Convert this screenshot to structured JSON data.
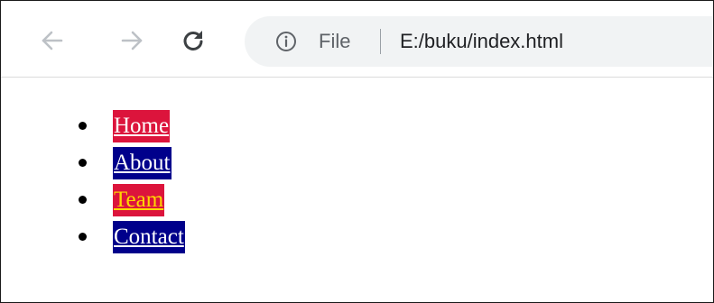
{
  "browser": {
    "origin_label": "File",
    "url": "E:/buku/index.html",
    "icons": {
      "back": "arrow-left-icon",
      "forward": "arrow-right-icon",
      "reload": "reload-icon",
      "info": "info-icon"
    }
  },
  "page": {
    "menu": [
      {
        "label": "Home",
        "bg": "#dc143c",
        "color": "#ffffff"
      },
      {
        "label": "About",
        "bg": "#00008b",
        "color": "#ffffff"
      },
      {
        "label": "Team",
        "bg": "#dc143c",
        "color": "#ffd700"
      },
      {
        "label": "Contact",
        "bg": "#00008b",
        "color": "#ffffff"
      }
    ]
  }
}
